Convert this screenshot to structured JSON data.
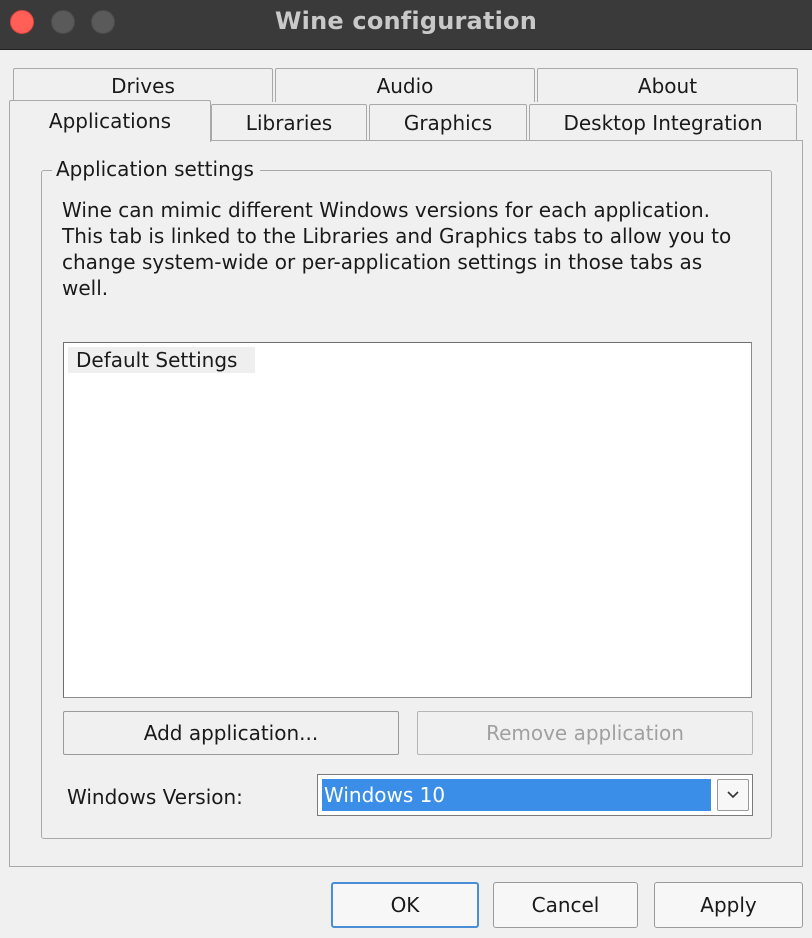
{
  "window": {
    "title": "Wine configuration"
  },
  "tabs": {
    "row1": [
      "Drives",
      "Audio",
      "About"
    ],
    "row2": [
      "Applications",
      "Libraries",
      "Graphics",
      "Desktop Integration"
    ],
    "active": "Applications"
  },
  "applications": {
    "group_title": "Application settings",
    "description_lines": [
      "Wine can mimic different Windows versions for each application.",
      "This tab is linked to the Libraries and Graphics tabs to allow you to",
      "change system-wide or per-application settings in those tabs as well."
    ],
    "app_list": [
      "Default Settings"
    ],
    "add_button": "Add application...",
    "remove_button": "Remove application",
    "remove_enabled": false,
    "windows_version_label": "Windows Version:",
    "windows_version_value": "Windows 10"
  },
  "footer": {
    "ok": "OK",
    "cancel": "Cancel",
    "apply": "Apply"
  },
  "colors": {
    "selection": "#3b8ee8",
    "close_button": "#ff5f57",
    "titlebar": "#3a3a3a"
  }
}
